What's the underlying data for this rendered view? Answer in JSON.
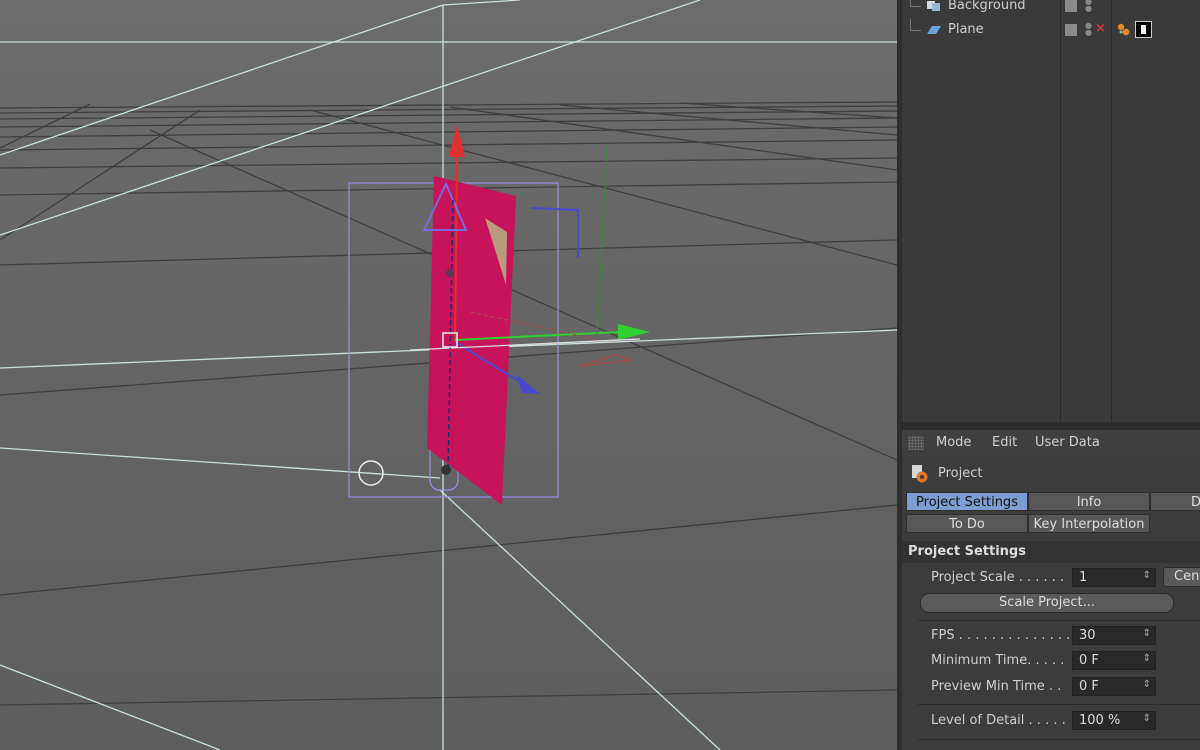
{
  "object_manager": {
    "objects": [
      {
        "name": "Background"
      },
      {
        "name": "Plane"
      }
    ]
  },
  "attribute_manager": {
    "menu": [
      "Mode",
      "Edit",
      "User Data"
    ],
    "title": "Project",
    "tabs_row1": [
      "Project Settings",
      "Info",
      "Dyn"
    ],
    "tabs_row2": [
      "To Do",
      "Key Interpolation"
    ],
    "section": "Project Settings",
    "project_scale": {
      "label": "Project Scale . . . . . .",
      "value": "1",
      "button": "Cent"
    },
    "scale_button": "Scale Project...",
    "fps": {
      "label": "FPS . . . . . . . . . . . . . . .",
      "value": "30"
    },
    "min_time": {
      "label": "Minimum Time. . . . .",
      "value": "0 F"
    },
    "preview_min": {
      "label": "Preview Min Time . .",
      "value": "0 F"
    },
    "level_detail": {
      "label": "Level of Detail . . . . .",
      "value": "100 %"
    },
    "spinner": "⇕"
  },
  "colors": {
    "accent_tab": "#7d9ed2",
    "plane": "#c7135a",
    "axis_x": "#e03030",
    "axis_y": "#30d030",
    "axis_z": "#4a4ad0",
    "bbox": "#9a8ae0"
  },
  "icons": [
    "background-object-icon",
    "plane-object-icon",
    "project-gear-icon",
    "material-tag-icon",
    "texture-tag-icon",
    "move-gizmo-icon"
  ]
}
